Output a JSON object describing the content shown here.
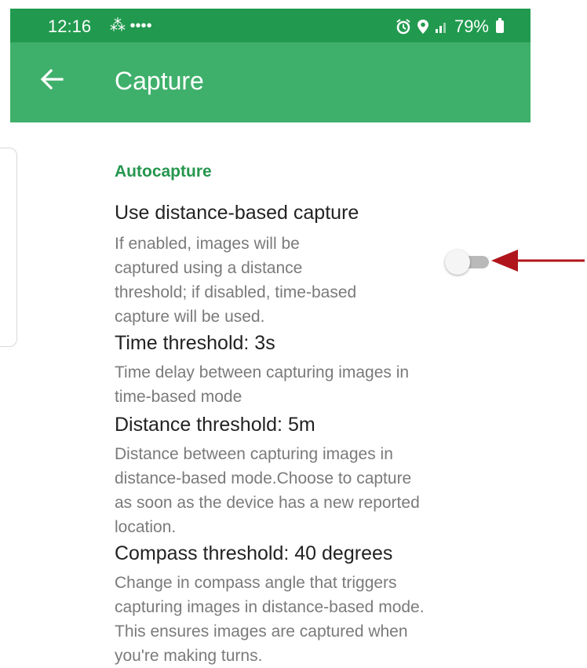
{
  "status_bar": {
    "time": "12:16",
    "notifications": "⁂ ••••",
    "battery": "79%",
    "icons": [
      "alarm-icon",
      "location-icon",
      "signal-icon",
      "battery-icon"
    ]
  },
  "app_bar": {
    "title": "Capture",
    "back_icon": "arrow-left-icon"
  },
  "section": {
    "title": "Autocapture"
  },
  "prefs": {
    "distance_based": {
      "title": "Use distance-based capture",
      "lines": [
        "If enabled, images will be",
        "captured using a distance",
        "threshold; if disabled, time-based",
        "capture will be used."
      ],
      "enabled": false
    },
    "time_threshold": {
      "title": "Time threshold: 3s",
      "lines": [
        "Time delay between capturing images in",
        "time-based mode"
      ]
    },
    "distance_threshold": {
      "title": "Distance threshold: 5m",
      "lines": [
        "Distance between capturing images in",
        "distance-based mode.Choose to capture",
        "as soon as the device has a new reported",
        "location."
      ]
    },
    "compass_threshold": {
      "title": "Compass threshold: 40 degrees",
      "lines": [
        "Change in compass angle that triggers",
        "capturing images in distance-based mode.",
        "This ensures images are captured when",
        "you're making turns."
      ]
    }
  },
  "colors": {
    "status_bar": "#219a4f",
    "app_bar": "#3fb06b",
    "accent": "#25964e",
    "annotation_arrow": "#b0151b"
  }
}
